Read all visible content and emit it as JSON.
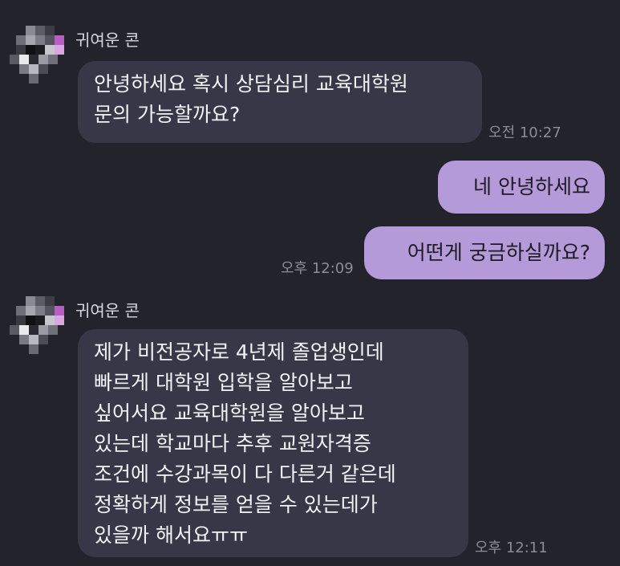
{
  "chat": {
    "contact_name": "귀여운 콘",
    "messages": [
      {
        "direction": "incoming",
        "sender": "귀여운 콘",
        "lines": [
          "안녕하세요 혹시 상담심리 교육대학원",
          "문의 가능할까요?"
        ],
        "time": "오전 10:27"
      },
      {
        "direction": "outgoing",
        "lines": [
          "네 안녕하세요"
        ]
      },
      {
        "direction": "outgoing",
        "lines": [
          "어떤게 궁금하실까요?"
        ],
        "time": "오후 12:09"
      },
      {
        "direction": "incoming",
        "sender": "귀여운 콘",
        "lines": [
          "제가 비전공자로 4년제 졸업생인데",
          "빠르게 대학원 입학을 알아보고",
          "싶어서요 교육대학원을 알아보고",
          "있는데 학교마다 추후 교원자격증",
          "조건에 수강과목이 다 다른거 같은데",
          "정확하게 정보를 얻을 수 있는데가",
          "있을까 해서요ㅠㅠ"
        ],
        "time": "오후 12:11"
      }
    ]
  },
  "colors": {
    "background": "#23232c",
    "incoming_bubble": "#373747",
    "outgoing_bubble": "#b49ad8",
    "time_text": "#8c8c96"
  },
  "icons": {
    "avatar": "pixelated-profile-avatar"
  }
}
